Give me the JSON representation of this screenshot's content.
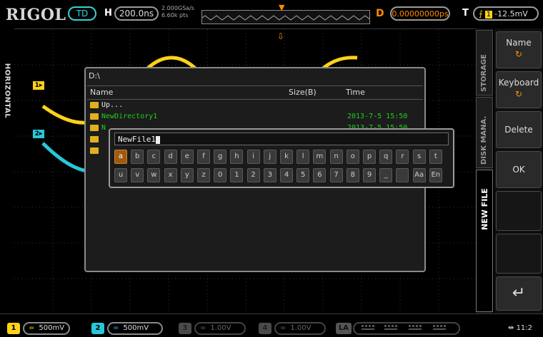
{
  "header": {
    "logo": "RIGOL",
    "mode": "TD",
    "h_label": "H",
    "timebase": "200.0ns",
    "sample_rate": "2.000GSa/s",
    "memory_depth": "6.60k pts",
    "d_label": "D",
    "delay": "0.00000000ps",
    "t_label": "T",
    "trigger_source": "1",
    "trigger_level": "-12.5mV"
  },
  "left_tab": {
    "label": "HORIZONTAL"
  },
  "dialog": {
    "path": "D:\\",
    "columns": [
      "Name",
      "Size(B)",
      "Time"
    ],
    "rows": [
      {
        "name": "Up...",
        "time": ""
      },
      {
        "name": "NewDirectory1",
        "time": "2013-7-5 15:50"
      },
      {
        "name": "N",
        "time": "2013-7-5 15:50"
      }
    ]
  },
  "keyboard": {
    "input_value": "NewFile1",
    "row1": [
      "a",
      "b",
      "c",
      "d",
      "e",
      "f",
      "g",
      "h",
      "i",
      "j",
      "k",
      "l",
      "m",
      "n",
      "o",
      "p",
      "q",
      "r",
      "s",
      "t"
    ],
    "row2": [
      "u",
      "v",
      "w",
      "x",
      "y",
      "z",
      "0",
      "1",
      "2",
      "3",
      "4",
      "5",
      "6",
      "7",
      "8",
      "9",
      "_",
      "",
      "Aa",
      "En"
    ],
    "selected_key": "a"
  },
  "vertical_tabs": [
    "STORAGE",
    "DISK MANA.",
    "NEW FILE"
  ],
  "menu": {
    "items": [
      {
        "label": "Name",
        "icon": "rotate-knob-icon"
      },
      {
        "label": "Keyboard",
        "icon": "rotate-knob-icon"
      },
      {
        "label": "Delete"
      },
      {
        "label": "OK"
      },
      {
        "label": "",
        "icon": "return-arrow-icon"
      }
    ]
  },
  "footer": {
    "ch1": {
      "num": "1",
      "coupling": "=",
      "scale": "500mV",
      "color": "#ffd21a"
    },
    "ch2": {
      "num": "2",
      "coupling": "=",
      "scale": "500mV",
      "color": "#28c8d8"
    },
    "ch3": {
      "num": "3",
      "coupling": "=",
      "scale": "1.00V"
    },
    "ch4": {
      "num": "4",
      "coupling": "=",
      "scale": "1.00V"
    },
    "la": "LA",
    "clock": "11:2"
  },
  "colors": {
    "ch1": "#ffd21a",
    "ch2": "#28c8d8",
    "accent": "#ff8a00",
    "file_green": "#1fd020"
  }
}
